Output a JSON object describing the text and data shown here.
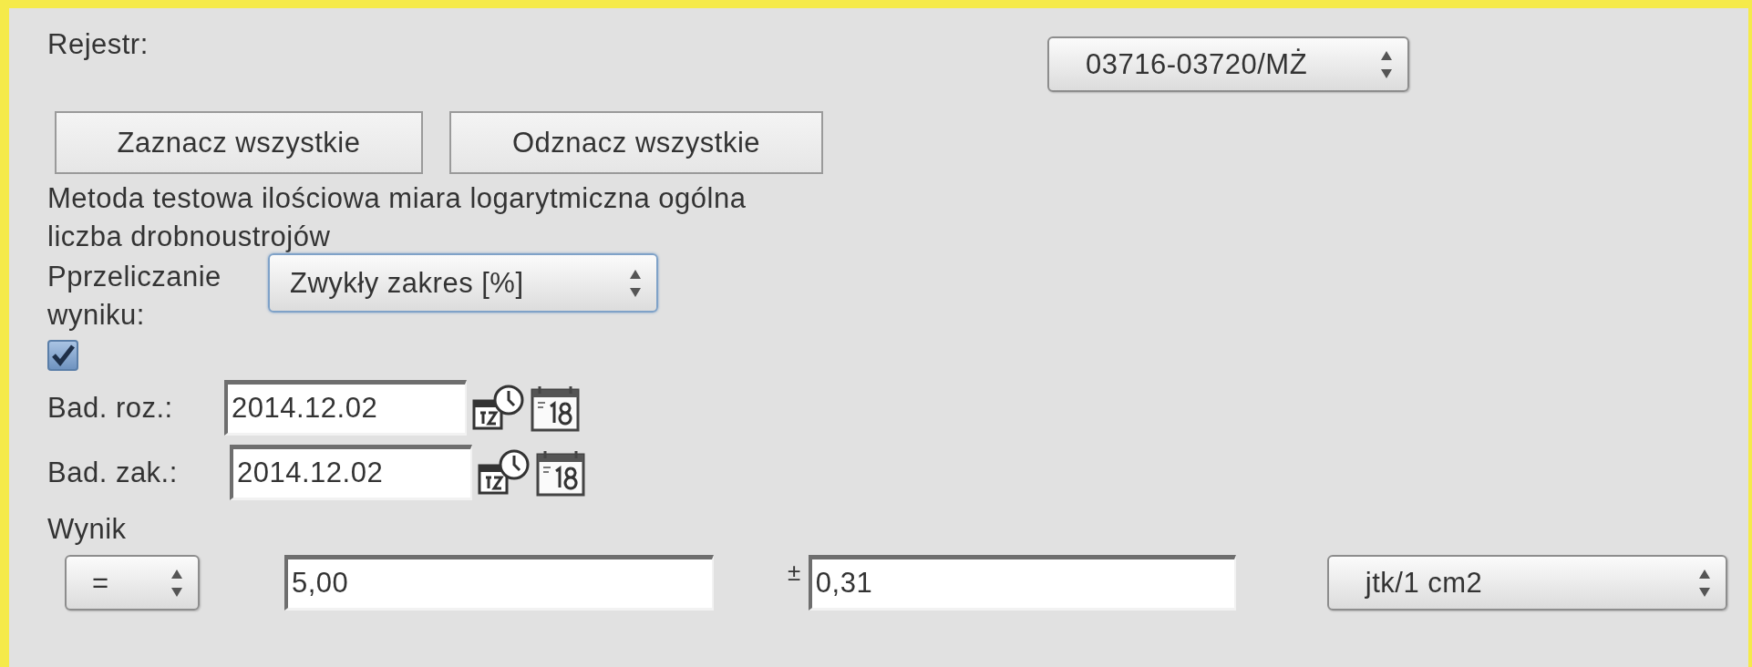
{
  "register": {
    "label": "Rejestr:",
    "value": "03716-03720/MŻ"
  },
  "buttons": [
    "Zaznacz wszystkie",
    "Odznacz wszystkie"
  ],
  "method": "Metoda testowa ilościowa miara logarytmiczna ogólna liczba drobnoustrojów",
  "conversion": {
    "label": "Pprzeliczanie wyniku:",
    "value": "Zwykły zakres [%]",
    "focused": true
  },
  "checkbox": {
    "checked": true
  },
  "dates": [
    {
      "label": "Bad. roz.:",
      "value": "2014.12.02"
    },
    {
      "label": "Bad. zak.:",
      "value": "2014.12.02"
    }
  ],
  "result": {
    "label": "Wynik",
    "operator": "=",
    "value": "5,00",
    "plusminus": "±",
    "uncertainty": "0,31",
    "unit": "jtk/1 cm2"
  }
}
